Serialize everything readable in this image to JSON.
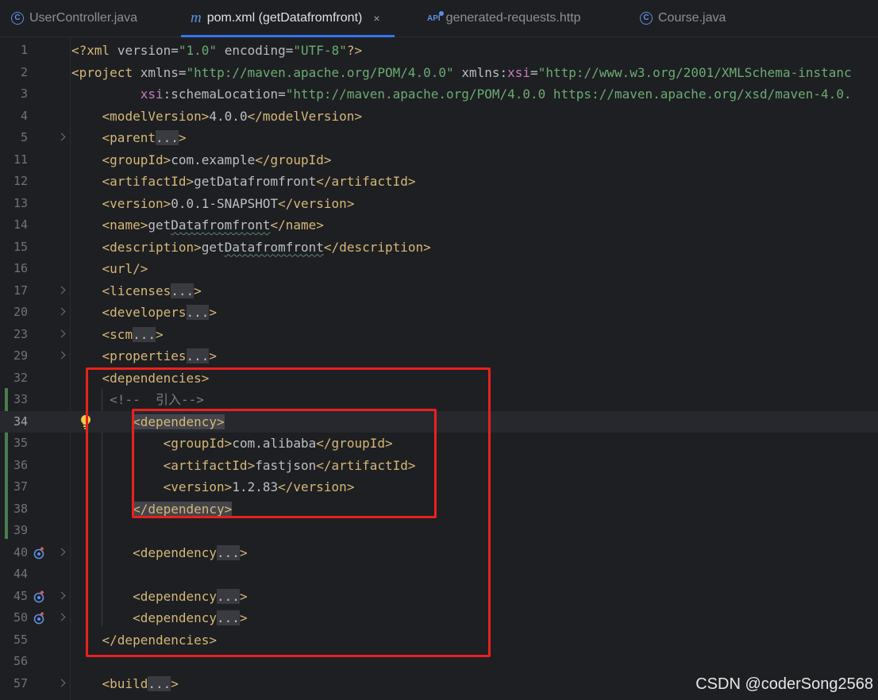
{
  "tabs": [
    {
      "label": "UserController.java",
      "icon": "class-icon",
      "active": false
    },
    {
      "label": "pom.xml (getDatafromfront)",
      "icon": "maven-icon",
      "active": true
    },
    {
      "label": "generated-requests.http",
      "icon": "api-icon",
      "active": false
    },
    {
      "label": "Course.java",
      "icon": "class-icon",
      "active": false
    }
  ],
  "tab_icon_glyphs": {
    "class": "C",
    "maven": "m",
    "api": "API"
  },
  "tab_close_glyph": "×",
  "lines": [
    {
      "num": "1"
    },
    {
      "num": "2"
    },
    {
      "num": "3"
    },
    {
      "num": "4"
    },
    {
      "num": "5"
    },
    {
      "num": "11"
    },
    {
      "num": "12"
    },
    {
      "num": "13"
    },
    {
      "num": "14"
    },
    {
      "num": "15"
    },
    {
      "num": "16"
    },
    {
      "num": "17"
    },
    {
      "num": "20"
    },
    {
      "num": "23"
    },
    {
      "num": "29"
    },
    {
      "num": "32"
    },
    {
      "num": "33"
    },
    {
      "num": "34"
    },
    {
      "num": "35"
    },
    {
      "num": "36"
    },
    {
      "num": "37"
    },
    {
      "num": "38"
    },
    {
      "num": "39"
    },
    {
      "num": "40"
    },
    {
      "num": "44"
    },
    {
      "num": "45"
    },
    {
      "num": "50"
    },
    {
      "num": "55"
    },
    {
      "num": "56"
    },
    {
      "num": "57"
    }
  ],
  "code": {
    "xml_decl": "?xml",
    "xml_decl_end": "?",
    "version_attr": "version",
    "version_val": "\"1.0\"",
    "encoding_attr": "encoding",
    "encoding_val": "\"UTF-8\"",
    "project": "project",
    "xmlns_attr": "xmlns",
    "xmlns_val": "\"http://maven.apache.org/POM/4.0.0\"",
    "xmlns_prefix": "xmlns",
    "xsi_ns": "xsi",
    "xsi_val": "\"http://www.w3.org/2001/XMLSchema-instanc",
    "schema_attr": "schemaLocation",
    "schema_val": "\"http://maven.apache.org/POM/4.0.0 https://maven.apache.org/xsd/maven-4.0.",
    "modelVersion": "modelVersion",
    "modelVersion_val": "4.0.0",
    "parent": "parent",
    "groupId": "groupId",
    "groupId_val": "com.example",
    "artifactId": "artifactId",
    "artifactId_val": "getDatafromfront",
    "version": "version",
    "version_val2": "0.0.1-SNAPSHOT",
    "name": "name",
    "name_pre": "get",
    "name_typo": "Datafromfront",
    "description": "description",
    "url": "url/",
    "licenses": "licenses",
    "developers": "developers",
    "scm": "scm",
    "properties": "properties",
    "dependencies": "dependencies",
    "comment": "<!--  引入-->",
    "dependency": "dependency",
    "dep_groupId_val": "com.alibaba",
    "dep_artifactId_val": "fastjson",
    "dep_version_val": "1.2.83",
    "build": "build",
    "folded": "..."
  },
  "watermark": "CSDN @coderSong2568",
  "colors": {
    "background": "#1e1f22",
    "tag": "#d5b778",
    "string": "#6aab73",
    "namespace": "#c77dbb",
    "comment": "#7a7e85",
    "highlight_box": "#e8211e",
    "tab_underline": "#3574f0"
  }
}
